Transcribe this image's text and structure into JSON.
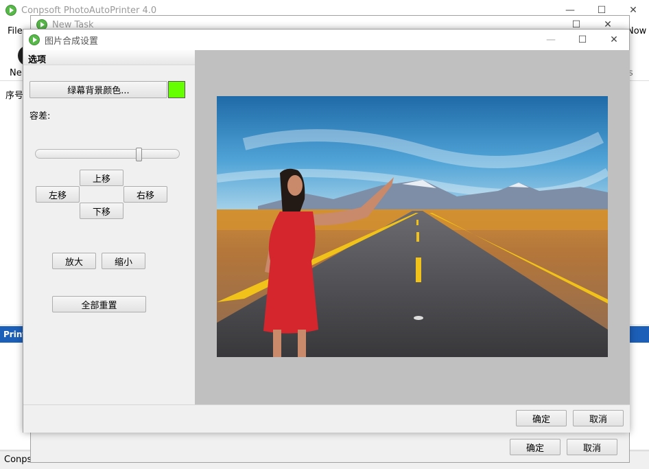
{
  "main_window": {
    "title": "Conpsoft PhotoAutoPrinter 4.0",
    "menu": {
      "file": "File",
      "now": "Now"
    },
    "toolbar": {
      "new_label": "Ne",
      "right_label": "s"
    },
    "grid": {
      "header_first": "序号"
    },
    "print_panel": {
      "label": "Print"
    },
    "status": {
      "text": "Conps"
    }
  },
  "new_task_window": {
    "title": "New Task",
    "ok_label": "确定",
    "cancel_label": "取消"
  },
  "dialog": {
    "title": "图片合成设置",
    "options_header": "选项",
    "green_bg_button": "绿幕背景颜色...",
    "green_bg_color": "#66ff00",
    "tolerance_label": "容差:",
    "tolerance_value": 0.72,
    "move_up": "上移",
    "move_left": "左移",
    "move_right": "右移",
    "move_down": "下移",
    "zoom_in": "放大",
    "zoom_out": "缩小",
    "reset_all": "全部重置",
    "ok_label": "确定",
    "cancel_label": "取消"
  },
  "window_controls": {
    "minimize": "—",
    "maximize": "☐",
    "close": "✕"
  }
}
